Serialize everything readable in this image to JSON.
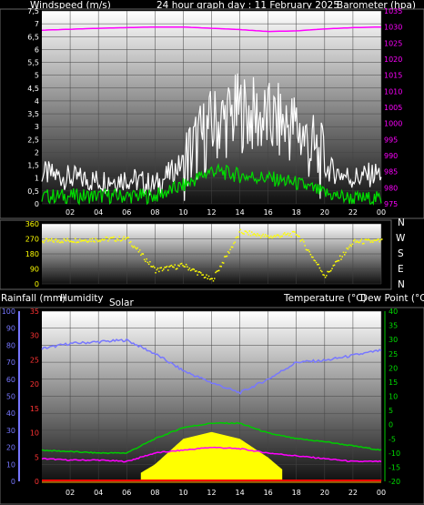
{
  "header": {
    "windspeed_label": "Windspeed (m/s)",
    "title": "24 hour graph day : 11 February 2025",
    "barometer_label": "Barometer (hpa)"
  },
  "middle": {
    "compass_labels": [
      "N",
      "W",
      "S",
      "E",
      "N"
    ]
  },
  "bottom_header": {
    "rainfall_label": "Rainfall (mm)",
    "humidity_label": "Humidity",
    "solar_label": "Solar",
    "temperature_label": "Temperature (°C)",
    "dewpoint_label": "Dew Point (°C)"
  },
  "colors": {
    "barometer": "#ff00ff",
    "wind_gust": "#ffffff",
    "wind_avg": "#00dd00",
    "direction": "#ffff00",
    "humidity": "#7777ff",
    "temperature": "#00cc00",
    "dewpoint": "#ff00ff",
    "solar": "#ffff00",
    "rain": "#ff0000"
  },
  "chart_data": [
    {
      "type": "line",
      "x_tick_labels": [
        "02",
        "04",
        "06",
        "08",
        "10",
        "12",
        "14",
        "16",
        "18",
        "20",
        "22",
        "00"
      ],
      "y_left_ticks": [
        "0",
        "0,5",
        "1",
        "1,5",
        "2",
        "2,5",
        "3",
        "3,5",
        "4",
        "4,5",
        "5",
        "5,5",
        "6",
        "6,5",
        "7",
        "7,5"
      ],
      "y_left_values": [
        0,
        0.5,
        1,
        1.5,
        2,
        2.5,
        3,
        3.5,
        4,
        4.5,
        5,
        5.5,
        6,
        6.5,
        7,
        7.5
      ],
      "y_right_ticks": [
        "975",
        "980",
        "985",
        "990",
        "995",
        "1000",
        "1005",
        "1010",
        "1015",
        "1020",
        "1025",
        "1030",
        "1035"
      ],
      "y_right_values": [
        975,
        980,
        985,
        990,
        995,
        1000,
        1005,
        1010,
        1015,
        1020,
        1025,
        1030,
        1035
      ],
      "ylim_left": [
        0,
        7.5
      ],
      "ylim_right": [
        975,
        1035
      ],
      "x_hours": [
        0,
        2,
        4,
        6,
        8,
        10,
        12,
        14,
        16,
        18,
        20,
        22,
        24
      ],
      "series": [
        {
          "key": "barometer",
          "axis": "right",
          "values": [
            1029,
            1029.3,
            1029.6,
            1029.8,
            1030,
            1030,
            1029.6,
            1029.2,
            1028.6,
            1028.8,
            1029.4,
            1029.8,
            1030
          ]
        },
        {
          "key": "wind_gust",
          "axis": "left",
          "values": [
            1.2,
            1.0,
            0.9,
            1.0,
            0.7,
            1.6,
            3.0,
            3.6,
            3.2,
            3.0,
            1.4,
            1.0,
            1.2
          ]
        },
        {
          "key": "wind_avg",
          "axis": "left",
          "values": [
            0.3,
            0.3,
            0.3,
            0.3,
            0.3,
            0.7,
            1.3,
            1.1,
            1.0,
            0.8,
            0.4,
            0.2,
            0.2
          ]
        }
      ]
    },
    {
      "type": "scatter",
      "x_tick_labels": [
        "02",
        "04",
        "06",
        "08",
        "10",
        "12",
        "14",
        "16",
        "18",
        "20",
        "22",
        "00"
      ],
      "y_ticks": [
        "0",
        "90",
        "180",
        "270",
        "360"
      ],
      "y_values": [
        0,
        90,
        180,
        270,
        360
      ],
      "ylim": [
        0,
        360
      ],
      "x_hours": [
        0,
        2,
        4,
        6,
        8,
        10,
        12,
        14,
        16,
        18,
        20,
        22,
        24
      ],
      "series": [
        {
          "key": "direction",
          "values": [
            255,
            260,
            265,
            270,
            80,
            110,
            20,
            310,
            280,
            300,
            45,
            250,
            255
          ]
        }
      ]
    },
    {
      "type": "area",
      "x_tick_labels": [
        "02",
        "04",
        "06",
        "08",
        "10",
        "12",
        "14",
        "16",
        "18",
        "20",
        "22",
        "00"
      ],
      "humidity_ticks": [
        "0",
        "10",
        "20",
        "30",
        "40",
        "50",
        "60",
        "70",
        "80",
        "90",
        "100"
      ],
      "humidity_values": [
        0,
        10,
        20,
        30,
        40,
        50,
        60,
        70,
        80,
        90,
        100
      ],
      "rain_ticks": [
        "0",
        "5",
        "10",
        "15",
        "20",
        "25",
        "30",
        "35"
      ],
      "rain_values": [
        0,
        5,
        10,
        15,
        20,
        25,
        30,
        35
      ],
      "temp_ticks": [
        "-20",
        "-15",
        "-10",
        "-5",
        "0",
        "5",
        "10",
        "15",
        "20",
        "25",
        "30",
        "35",
        "40"
      ],
      "temp_values": [
        -20,
        -15,
        -10,
        -5,
        0,
        5,
        10,
        15,
        20,
        25,
        30,
        35,
        40
      ],
      "ylim_humidity": [
        0,
        100
      ],
      "ylim_rain": [
        0,
        35
      ],
      "ylim_temp": [
        -20,
        40
      ],
      "x_hours": [
        0,
        2,
        4,
        6,
        8,
        10,
        12,
        14,
        16,
        18,
        20,
        22,
        24
      ],
      "series": [
        {
          "key": "humidity",
          "axis": "humidity",
          "values": [
            78,
            81,
            82,
            83,
            75,
            65,
            58,
            52,
            60,
            70,
            71,
            74,
            77
          ]
        },
        {
          "key": "temperature",
          "axis": "temp",
          "values": [
            -9,
            -9.5,
            -10,
            -10,
            -5,
            -1,
            0.5,
            0.5,
            -3,
            -5,
            -6,
            -7.5,
            -9
          ]
        },
        {
          "key": "dewpoint",
          "axis": "temp",
          "values": [
            -12,
            -12.5,
            -12.5,
            -13,
            -10,
            -9,
            -8,
            -8.5,
            -10,
            -11,
            -12,
            -13,
            -13
          ]
        },
        {
          "key": "solar",
          "axis": "humidity",
          "values": [
            0,
            0,
            0,
            0,
            10,
            25,
            29,
            25,
            14,
            0,
            0,
            0,
            0
          ]
        },
        {
          "key": "rain",
          "axis": "rain",
          "values": [
            0,
            0,
            0,
            0,
            0,
            0,
            0,
            0,
            0,
            0,
            0,
            0,
            0
          ]
        }
      ]
    }
  ]
}
